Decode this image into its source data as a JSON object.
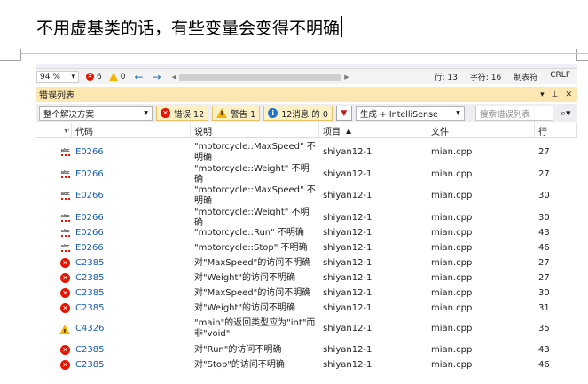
{
  "document": {
    "text": "不用虚基类的话，有些变量会变得不明确"
  },
  "statusbar": {
    "zoom": "94 %",
    "errors": "6",
    "warnings": "0",
    "line": "行: 13",
    "char": "字符: 16",
    "tabs": "制表符",
    "eol": "CRLF"
  },
  "panel": {
    "title": "错误列表",
    "scope": "整个解决方案",
    "errors_btn": "错误 12",
    "warnings_btn": "警告 1",
    "messages_btn": "12消息 的 0",
    "build_filter": "生成 + IntelliSense",
    "search_placeholder": "搜索错误列表"
  },
  "columns": {
    "code": "代码",
    "desc": "说明",
    "project": "项目",
    "file": "文件",
    "line": "行"
  },
  "colors": {
    "error": "#e51400",
    "warning": "#f4b400",
    "info": "#1e74c8",
    "panel_title": "#fce7b2"
  },
  "rows": [
    {
      "icon": "intellisense-error-icon",
      "code": "E0266",
      "desc": "\"motorcycle::MaxSpeed\" 不明确",
      "project": "shiyan12-1",
      "file": "mian.cpp",
      "line": "27"
    },
    {
      "icon": "intellisense-error-icon",
      "code": "E0266",
      "desc": "\"motorcycle::Weight\" 不明确",
      "project": "shiyan12-1",
      "file": "mian.cpp",
      "line": "27"
    },
    {
      "icon": "intellisense-error-icon",
      "code": "E0266",
      "desc": "\"motorcycle::MaxSpeed\" 不明确",
      "project": "shiyan12-1",
      "file": "mian.cpp",
      "line": "30"
    },
    {
      "icon": "intellisense-error-icon",
      "code": "E0266",
      "desc": "\"motorcycle::Weight\" 不明确",
      "project": "shiyan12-1",
      "file": "mian.cpp",
      "line": "30"
    },
    {
      "icon": "intellisense-error-icon",
      "code": "E0266",
      "desc": "\"motorcycle::Run\" 不明确",
      "project": "shiyan12-1",
      "file": "mian.cpp",
      "line": "43"
    },
    {
      "icon": "intellisense-error-icon",
      "code": "E0266",
      "desc": "\"motorcycle::Stop\" 不明确",
      "project": "shiyan12-1",
      "file": "mian.cpp",
      "line": "46"
    },
    {
      "icon": "error-icon",
      "code": "C2385",
      "desc": "对\"MaxSpeed\"的访问不明确",
      "project": "shiyan12-1",
      "file": "mian.cpp",
      "line": "27"
    },
    {
      "icon": "error-icon",
      "code": "C2385",
      "desc": "对\"Weight\"的访问不明确",
      "project": "shiyan12-1",
      "file": "mian.cpp",
      "line": "27"
    },
    {
      "icon": "error-icon",
      "code": "C2385",
      "desc": "对\"MaxSpeed\"的访问不明确",
      "project": "shiyan12-1",
      "file": "mian.cpp",
      "line": "30"
    },
    {
      "icon": "error-icon",
      "code": "C2385",
      "desc": "对\"Weight\"的访问不明确",
      "project": "shiyan12-1",
      "file": "mian.cpp",
      "line": "31"
    },
    {
      "icon": "warning-icon",
      "code": "C4326",
      "desc": "\"main\"的返回类型应为\"int\"而非\"void\"",
      "project": "shiyan12-1",
      "file": "mian.cpp",
      "line": "35"
    },
    {
      "icon": "error-icon",
      "code": "C2385",
      "desc": "对\"Run\"的访问不明确",
      "project": "shiyan12-1",
      "file": "mian.cpp",
      "line": "43"
    },
    {
      "icon": "error-icon",
      "code": "C2385",
      "desc": "对\"Stop\"的访问不明确",
      "project": "shiyan12-1",
      "file": "mian.cpp",
      "line": "46"
    }
  ]
}
